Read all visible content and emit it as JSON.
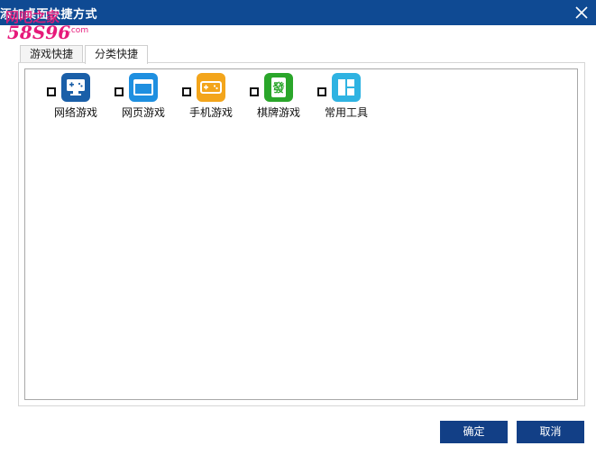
{
  "window": {
    "title": "添加桌面快捷方式",
    "close_icon": "close-icon"
  },
  "watermark": {
    "line1": "网吧之家",
    "line2": "58S96",
    "suffix": ".com"
  },
  "tabs": [
    {
      "label": "游戏快捷",
      "active": false
    },
    {
      "label": "分类快捷",
      "active": true
    }
  ],
  "categories": [
    {
      "label": "网络游戏",
      "icon": "monitor-gamepad-icon",
      "color": "#1a5fa8",
      "checked": false
    },
    {
      "label": "网页游戏",
      "icon": "browser-window-icon",
      "color": "#1e8fe0",
      "checked": false
    },
    {
      "label": "手机游戏",
      "icon": "handheld-game-icon",
      "color": "#f3a51b",
      "checked": false
    },
    {
      "label": "棋牌游戏",
      "icon": "mahjong-tile-icon",
      "color": "#2aa62a",
      "checked": false
    },
    {
      "label": "常用工具",
      "icon": "tools-grid-icon",
      "color": "#2fb3e2",
      "checked": false
    }
  ],
  "mahjong_glyph": "發",
  "buttons": {
    "ok": "确定",
    "cancel": "取消"
  },
  "colors": {
    "titlebar": "#0f4a93",
    "button": "#123f86",
    "watermark_pink": "#e6197a"
  }
}
